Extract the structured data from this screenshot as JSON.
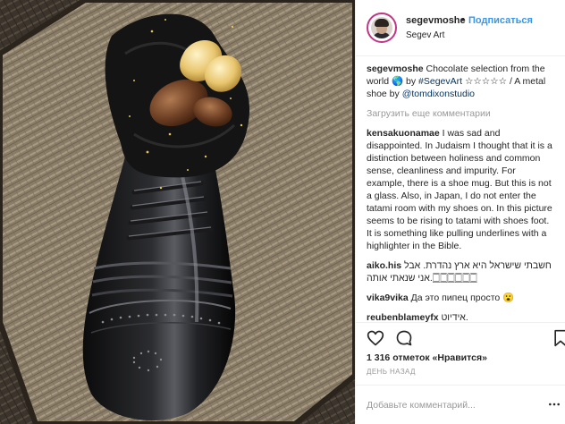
{
  "post": {
    "image_alt": "",
    "header": {
      "username": "segevmoshe",
      "separator": "•",
      "follow_label": "Подписаться",
      "location": "Segev Art"
    },
    "caption": {
      "username": "segevmoshe",
      "text_before": " Chocolate selection from the world ",
      "emoji": "🌎",
      "text_by": " by ",
      "hashtag": "#SegevArt",
      "stars": " ☆☆☆☆☆ / A metal shoe by ",
      "mention": "@tomdixonstudio"
    },
    "load_more_label": "Загрузить еще комментарии",
    "comments": [
      {
        "username": "kensakuonamae",
        "text": " I was sad and disappointed. In Judaism I thought that it is a distinction between holiness and common sense, cleanliness and impurity. For example, there is a shoe mug. But this is not a glass. Also, in Japan, I do not enter the tatami room with my shoes on. In this picture seems to be rising to tatami with shoes foot. It is something like pulling underlines with a highlighter in the Bible."
      },
      {
        "username": "aiko.his",
        "text": " חשבתי שישראל היא ארץ נהדרת. אבל אני שנאתי אותה.🀆🀆🀆🀆🀆🀆"
      },
      {
        "username": "vika9vika",
        "text": " Да это пипец просто 😮"
      },
      {
        "username": "reubenblameyfx",
        "text": " אידיוט."
      }
    ],
    "likes_count_text": "1 316 отметок «Нравится»",
    "age_text": "ДЕНЬ НАЗАД",
    "add_comment_placeholder": "Добавьте комментарий...",
    "icons": {
      "like": "heart-icon",
      "comment": "comment-icon",
      "save": "bookmark-icon",
      "more": "more-options-icon"
    },
    "colors": {
      "follow": "#3897f0",
      "text": "#262626",
      "muted": "#999999",
      "link": "#003569",
      "avatar_ring": "#c13584"
    }
  }
}
